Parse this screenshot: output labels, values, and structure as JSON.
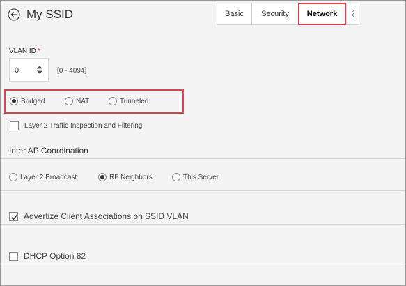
{
  "header": {
    "title": "My SSID",
    "tabs": {
      "basic": "Basic",
      "security": "Security",
      "network": "Network"
    },
    "active_tab": "Network"
  },
  "vlan": {
    "label": "VLAN ID",
    "required_mark": "*",
    "value": "0",
    "range": "[0 - 4094]"
  },
  "mode": {
    "options": [
      "Bridged",
      "NAT",
      "Tunneled"
    ],
    "selected": "Bridged"
  },
  "l2_inspection": {
    "label": "Layer 2 Traffic Inspection and Filtering",
    "checked": false
  },
  "inter_ap": {
    "title": "Inter AP Coordination",
    "options": [
      "Layer 2 Broadcast",
      "RF Neighbors",
      "This Server"
    ],
    "selected": "RF Neighbors"
  },
  "advertize": {
    "label": "Advertize Client Associations on SSID VLAN",
    "checked": true
  },
  "dhcp82": {
    "label": "DHCP Option 82",
    "checked": false
  },
  "colors": {
    "highlight": "#d9434f",
    "background": "#f4f4f4"
  },
  "icons": {
    "back": "back-arrow-circle-icon",
    "spin": "spinner-arrows-icon",
    "more": "more-dots-icon",
    "check": "checkmark-icon"
  }
}
